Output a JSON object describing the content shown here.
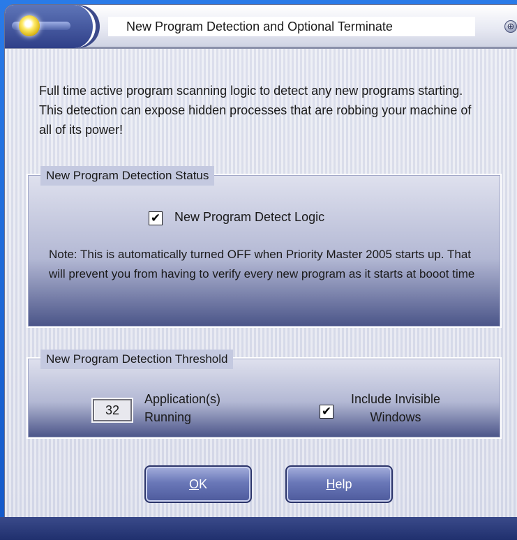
{
  "window": {
    "title": "New Program Detection and Optional Terminate",
    "title_button_glyph": "⊕"
  },
  "intro_text": "Full time active program scanning logic to detect any new programs starting. This detection can expose hidden processes that are robbing your machine of all of its power!",
  "status_group": {
    "legend": "New Program Detection Status",
    "detect_checkbox": {
      "label": "New Program Detect Logic",
      "checked": true,
      "mark": "✔"
    },
    "note": "Note: This is automatically turned OFF when Priority Master 2005 starts up. That will prevent you from having to verify every new program as it starts at booot time"
  },
  "threshold_group": {
    "legend": "New Program Detection Threshold",
    "count_value": "32",
    "apps_label_line1": "Application(s)",
    "apps_label_line2": "Running",
    "invisible_checkbox": {
      "label_line1": "Include Invisible",
      "label_line2": "Windows",
      "checked": true,
      "mark": "✔"
    }
  },
  "buttons": {
    "ok_label": "OK",
    "ok_mnemonic": "O",
    "ok_rest": "K",
    "help_label": "Help",
    "help_mnemonic": "H",
    "help_rest": "elp"
  },
  "colors": {
    "desktop_blue": "#1b6ad8",
    "button_face": "#6a78b8",
    "group_dark": "#4a5488"
  },
  "icons": {
    "orb": "yellow-orb-icon",
    "title_button": "plus-circle-icon"
  }
}
